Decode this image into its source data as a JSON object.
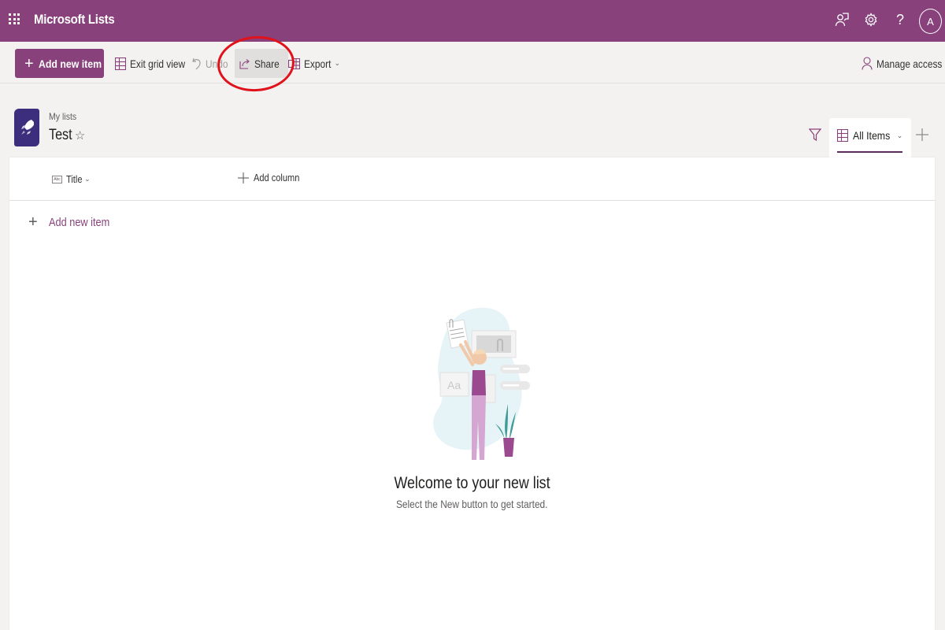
{
  "app": {
    "title": "Microsoft Lists",
    "avatar_initial": "A",
    "brand_color": "#88417b"
  },
  "suitebar": {
    "icons": [
      "waffle-icon",
      "feedback-icon",
      "settings-icon",
      "help-icon",
      "avatar"
    ]
  },
  "toolbar": {
    "add_new_item": "Add new item",
    "exit_grid_view": "Exit grid view",
    "undo": "Undo",
    "share": "Share",
    "export": "Export",
    "manage_access": "Manage access"
  },
  "annotation": {
    "highlight_color": "#e0121b",
    "highlighted_target": "Share"
  },
  "header": {
    "breadcrumb": "My lists",
    "list_title": "Test",
    "favorite_star": "☆"
  },
  "views": {
    "current": "All Items",
    "add_view_symbol": "+"
  },
  "grid": {
    "columns": [
      {
        "label": "Title",
        "type_icon": "Abc"
      }
    ],
    "add_column": "Add column",
    "add_new_item": "Add new item"
  },
  "empty_state": {
    "heading": "Welcome to your new list",
    "subtext": "Select the New button to get started.",
    "illustration_text": "Aa"
  }
}
